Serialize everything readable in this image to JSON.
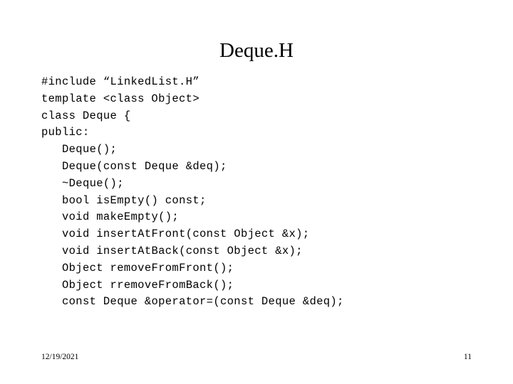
{
  "slide": {
    "title": "Deque.H",
    "background_color": "#ffffff",
    "text_color": "#000000",
    "code_lines": [
      {
        "text": "#include “LinkedList.H”",
        "indent": false
      },
      {
        "text": "template <class Object>",
        "indent": false
      },
      {
        "text": "class Deque {",
        "indent": false
      },
      {
        "text": "public:",
        "indent": false
      },
      {
        "text": "Deque();",
        "indent": true
      },
      {
        "text": "Deque(const Deque &deq);",
        "indent": true
      },
      {
        "text": "~Deque();",
        "indent": true
      },
      {
        "text": "bool isEmpty() const;",
        "indent": true
      },
      {
        "text": "void makeEmpty();",
        "indent": true
      },
      {
        "text": "void insertAtFront(const Object &x);",
        "indent": true
      },
      {
        "text": "void insertAtBack(const Object &x);",
        "indent": true
      },
      {
        "text": "Object removeFromFront();",
        "indent": true
      },
      {
        "text": "Object rremoveFromBack();",
        "indent": true
      },
      {
        "text": "const Deque &operator=(const Deque &deq);",
        "indent": true
      }
    ],
    "footer": {
      "date": "12/19/2021",
      "page_number": "11"
    }
  }
}
